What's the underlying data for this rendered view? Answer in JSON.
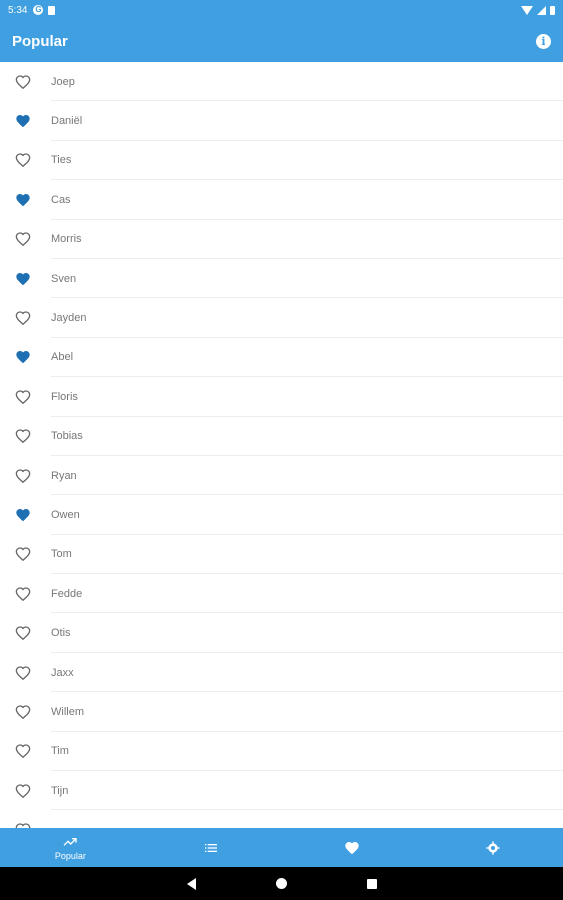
{
  "status_bar": {
    "time": "5:34",
    "g_letter": "G"
  },
  "app_bar": {
    "title": "Popular",
    "info_symbol": "i"
  },
  "colors": {
    "accent": "#3f9fe0",
    "heart_filled": "#1f6fb3",
    "heart_outline": "#666666"
  },
  "names": [
    {
      "name": "Joep",
      "favorite": false
    },
    {
      "name": "Daniël",
      "favorite": true
    },
    {
      "name": "Ties",
      "favorite": false
    },
    {
      "name": "Cas",
      "favorite": true
    },
    {
      "name": "Morris",
      "favorite": false
    },
    {
      "name": "Sven",
      "favorite": true
    },
    {
      "name": "Jayden",
      "favorite": false
    },
    {
      "name": "Abel",
      "favorite": true
    },
    {
      "name": "Floris",
      "favorite": false
    },
    {
      "name": "Tobias",
      "favorite": false
    },
    {
      "name": "Ryan",
      "favorite": false
    },
    {
      "name": "Owen",
      "favorite": true
    },
    {
      "name": "Tom",
      "favorite": false
    },
    {
      "name": "Fedde",
      "favorite": false
    },
    {
      "name": "Otis",
      "favorite": false
    },
    {
      "name": "Jaxx",
      "favorite": false
    },
    {
      "name": "Willem",
      "favorite": false
    },
    {
      "name": "Tim",
      "favorite": false
    },
    {
      "name": "Tijn",
      "favorite": false
    },
    {
      "name": "",
      "favorite": false
    }
  ],
  "bottom_nav": [
    {
      "icon": "trending-up-icon",
      "label": "Popular",
      "active": true
    },
    {
      "icon": "list-icon",
      "label": "",
      "active": false
    },
    {
      "icon": "heart-icon",
      "label": "",
      "active": false
    },
    {
      "icon": "settings-icon",
      "label": "",
      "active": false
    }
  ]
}
